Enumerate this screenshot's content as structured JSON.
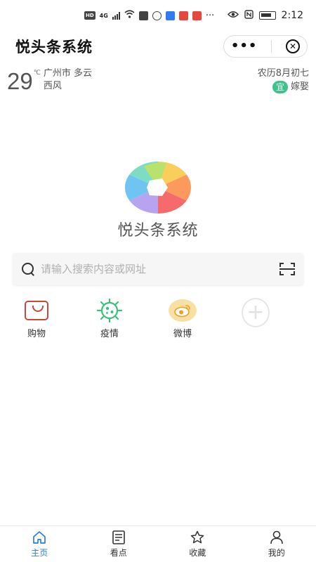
{
  "status_bar": {
    "network_badge": "HD",
    "network_type": "4G",
    "more_indicator": "···",
    "time": "2:12",
    "icons": [
      "hd-badge-icon",
      "signal-icon",
      "wifi-icon",
      "upload-icon",
      "sync-icon",
      "app-notify-icon",
      "mail-icon",
      "app-red-icon",
      "eye-icon",
      "nfc-icon",
      "battery-icon"
    ]
  },
  "titlebar": {
    "title": "悦头条系统",
    "more_label": "•••",
    "close_label": "✕"
  },
  "weather": {
    "temperature": "29",
    "unit": "℃",
    "location_condition": "广州市 多云",
    "wind": "西风",
    "lunar_date": "农历8月初七",
    "almanac_badge": "宜",
    "almanac_text": "嫁娶"
  },
  "logo": {
    "title": "悦头条系统",
    "colors": [
      "#f9cf5a",
      "#fb9a5c",
      "#f56b6b",
      "#b8a3f0",
      "#6fc4f2",
      "#7ddcc4",
      "#b9e26c"
    ]
  },
  "search": {
    "placeholder": "请输入搜索内容或网址",
    "value": ""
  },
  "shortcuts": [
    {
      "label": "购物",
      "icon": "shopping-bag-icon"
    },
    {
      "label": "疫情",
      "icon": "virus-icon"
    },
    {
      "label": "微博",
      "icon": "weibo-icon"
    },
    {
      "label": "",
      "icon": "add-icon"
    }
  ],
  "tabbar": {
    "active": "主页",
    "items": [
      {
        "label": "主页",
        "icon": "home-icon"
      },
      {
        "label": "看点",
        "icon": "news-icon"
      },
      {
        "label": "收藏",
        "icon": "star-icon"
      },
      {
        "label": "我的",
        "icon": "user-icon"
      }
    ],
    "active_color": "#2b7de9"
  }
}
